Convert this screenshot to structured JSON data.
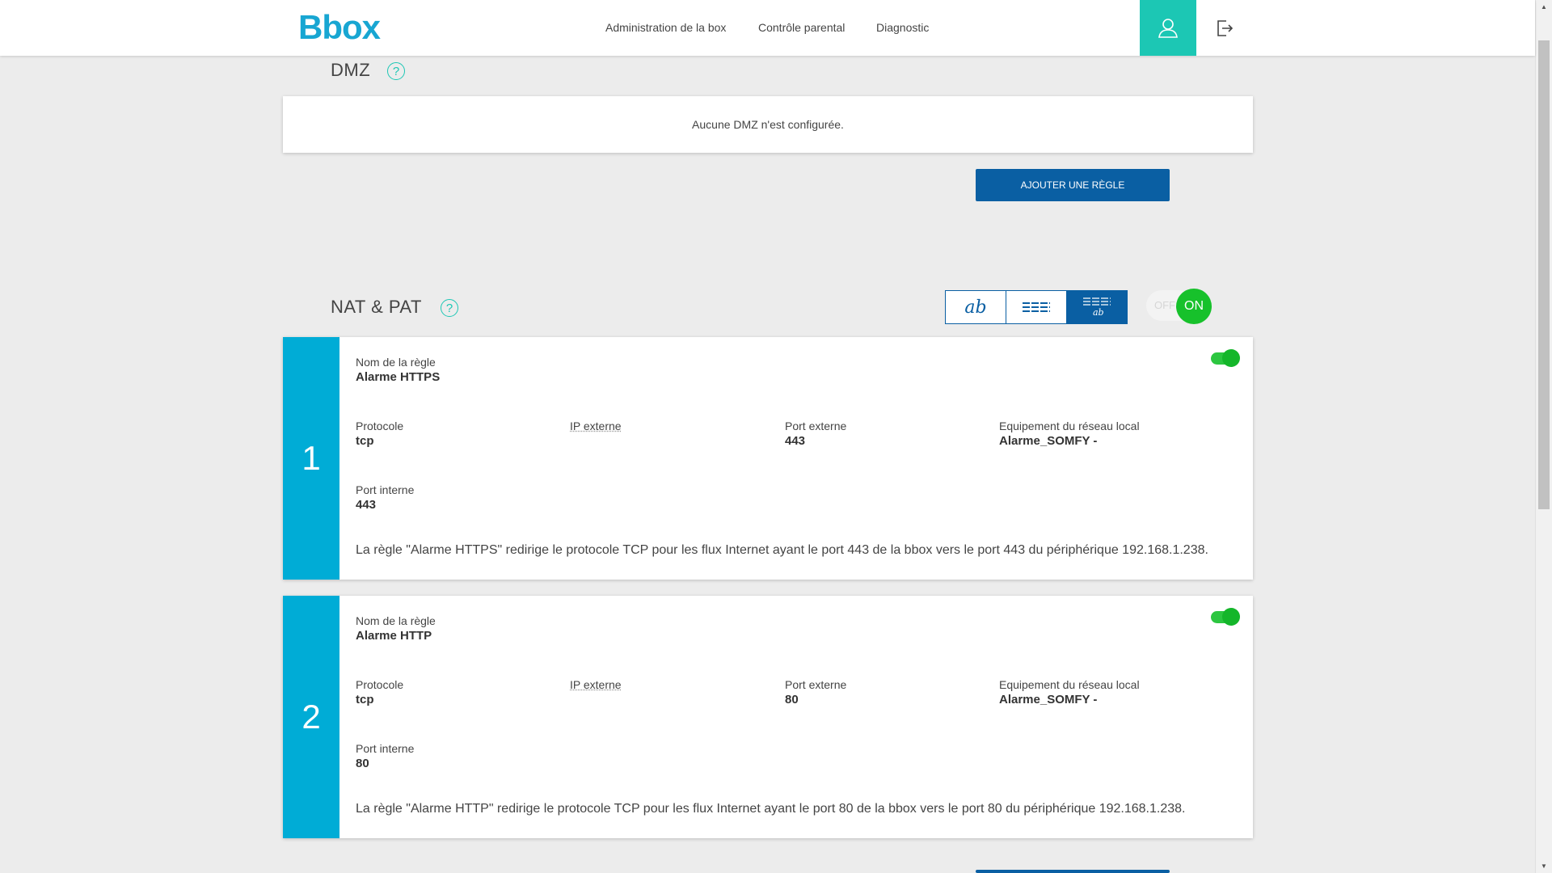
{
  "header": {
    "logo": "Bbox",
    "nav": [
      {
        "label": "Administration de la box"
      },
      {
        "label": "Contrôle parental"
      },
      {
        "label": "Diagnostic"
      }
    ]
  },
  "dmz": {
    "title": "DMZ",
    "help": "?",
    "empty_message": "Aucune DMZ n'est configurée.",
    "add_rule_label": "AJOUTER UNE RÈGLE"
  },
  "nat": {
    "title": "NAT & PAT",
    "help": "?",
    "views": [
      {
        "glyph": "ab",
        "icon": "text-view-icon"
      },
      {
        "glyph": "≡",
        "icon": "list-view-icon"
      },
      {
        "glyph": "ab",
        "icon": "detailed-view-icon"
      }
    ],
    "switch": {
      "off_label": "OFF",
      "on_label": "ON",
      "state": "on"
    },
    "labels": {
      "rule_name": "Nom de la règle",
      "protocol": "Protocole",
      "external_ip": "IP externe",
      "external_port": "Port externe",
      "local_device": "Equipement du réseau local",
      "internal_port": "Port interne"
    },
    "rules": [
      {
        "number": "1",
        "name": "Alarme HTTPS",
        "protocol": "tcp",
        "external_ip": "",
        "external_port": "443",
        "local_device": "Alarme_SOMFY -",
        "internal_port": "443",
        "enabled": true,
        "description": "La règle \"Alarme HTTPS\" redirige le protocole TCP pour les flux Internet ayant le port 443 de la bbox vers le port 443 du périphérique 192.168.1.238."
      },
      {
        "number": "2",
        "name": "Alarme HTTP",
        "protocol": "tcp",
        "external_ip": "",
        "external_port": "80",
        "local_device": "Alarme_SOMFY -",
        "internal_port": "80",
        "enabled": true,
        "description": "La règle \"Alarme HTTP\" redirige le protocole TCP pour les flux Internet ayant le port 80 de la bbox vers le port 80 du périphérique 192.168.1.238."
      }
    ]
  },
  "colors": {
    "brand": "#18a6d2",
    "teal": "#1cc7b4",
    "primary_button": "#0a5fa3",
    "rule_number_bg": "#00acd6",
    "switch_on": "#17c12b"
  }
}
